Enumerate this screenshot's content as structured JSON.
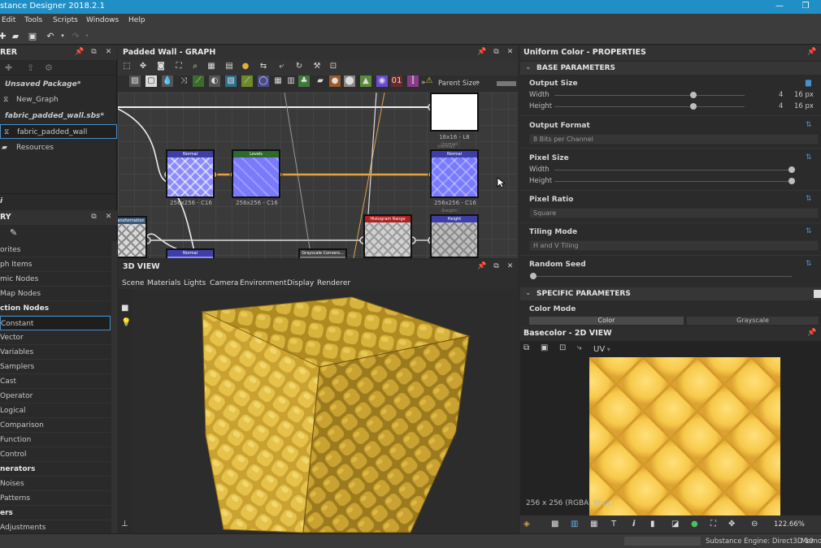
{
  "window": {
    "title": "stance Designer 2018.2.1",
    "minimize_glyph": "—",
    "maximize_glyph": "❐"
  },
  "menu": [
    "Edit",
    "Tools",
    "Scripts",
    "Windows",
    "Help"
  ],
  "toolbar_icons": [
    "new-icon",
    "open-folder-icon",
    "save-icon",
    "undo-icon",
    "redo-icon"
  ],
  "explorer": {
    "title": "RER",
    "items": [
      {
        "label": "Unsaved Package*",
        "style": "italic-bold"
      },
      {
        "label": "New_Graph",
        "style": "graph"
      },
      {
        "label": "fabric_padded_wall.sbs*",
        "style": "italic-bold"
      },
      {
        "label": "fabric_padded_wall",
        "style": "graph-selected"
      },
      {
        "label": "Resources",
        "style": "folder"
      }
    ]
  },
  "library": {
    "title": "RY",
    "items": [
      {
        "label": "orites",
        "header": false
      },
      {
        "label": "ph Items",
        "header": false
      },
      {
        "label": "mic Nodes",
        "header": false
      },
      {
        "label": "Map Nodes",
        "header": false
      },
      {
        "label": "ction Nodes",
        "header": true
      },
      {
        "label": "Constant",
        "header": false,
        "selected": true
      },
      {
        "label": "Vector",
        "header": false
      },
      {
        "label": "Variables",
        "header": false
      },
      {
        "label": "Samplers",
        "header": false
      },
      {
        "label": "Cast",
        "header": false
      },
      {
        "label": "Operator",
        "header": false
      },
      {
        "label": "Logical",
        "header": false
      },
      {
        "label": "Comparison",
        "header": false
      },
      {
        "label": "Function",
        "header": false
      },
      {
        "label": "Control",
        "header": false
      },
      {
        "label": "nerators",
        "header": true
      },
      {
        "label": "Noises",
        "header": false
      },
      {
        "label": "Patterns",
        "header": false
      },
      {
        "label": "ers",
        "header": true
      },
      {
        "label": "Adjustments",
        "header": false
      }
    ]
  },
  "graph": {
    "title": "Padded Wall - GRAPH",
    "parent_size_label": "Parent Size:",
    "nodes": {
      "uniform_label": "16x16 - L8",
      "uniform_tag": "(normal)",
      "normal1_head": "Normal",
      "normal1_label": "256x256 - C16",
      "levels_head": "Levels",
      "levels_label": "256x256 - C16",
      "normal2_head": "Normal",
      "normal2_tag": "(normal)",
      "normal2_label": "256x256 - C16",
      "trans_head": "ansformation 2D",
      "normal3_head": "Normal",
      "gray_head": "Grayscale Convers...",
      "hist_head": "Histogram Range",
      "height_head": "Height",
      "height_tag": "(height)"
    }
  },
  "view3d": {
    "title": "3D VIEW",
    "menu": [
      "Scene",
      "Materials",
      "Lights",
      "Camera",
      "Environment",
      "Display",
      "Renderer"
    ]
  },
  "properties": {
    "title": "Uniform Color - PROPERTIES",
    "base_section": "BASE PARAMETERS",
    "output_size": {
      "label": "Output Size",
      "width_label": "Width",
      "height_label": "Height",
      "width_value": "4",
      "height_value": "4",
      "width_px": "16 px",
      "height_px": "16 px",
      "width_pos": 0.73,
      "height_pos": 0.73
    },
    "output_format": {
      "label": "Output Format",
      "value": "8 Bits per Channel"
    },
    "pixel_size": {
      "label": "Pixel Size",
      "width_label": "Width",
      "height_label": "Height"
    },
    "pixel_ratio": {
      "label": "Pixel Ratio",
      "value": "Square"
    },
    "tiling_mode": {
      "label": "Tiling Mode",
      "value": "H and V Tiling"
    },
    "random_seed": {
      "label": "Random Seed"
    },
    "specific_section": "SPECIFIC PARAMETERS",
    "color_mode": {
      "label": "Color Mode",
      "option_a": "Color",
      "option_b": "Grayscale"
    }
  },
  "view2d": {
    "title": "Basecolor - 2D VIEW",
    "uv_label": "UV",
    "info": "256 x 256 (RGBA, 8bpc)",
    "zoom": "122.66%"
  },
  "statusbar": {
    "engine": "Substance Engine: Direct3D 10",
    "memory": "Memory"
  },
  "colors": {
    "accent": "#1f8fc6",
    "wire": "#e8a040",
    "node_border": "#111111"
  }
}
